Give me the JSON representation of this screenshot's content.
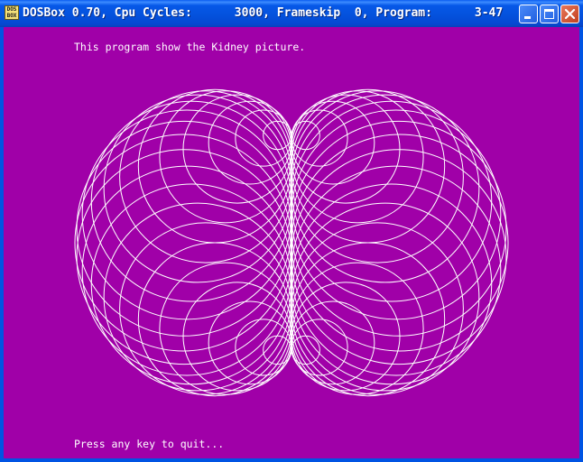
{
  "window": {
    "title": "DOSBox 0.70, Cpu Cycles:      3000, Frameskip  0, Program:      3-47",
    "icon_label_top": "DOS",
    "icon_label_bottom": "BOX",
    "controls": [
      "minimize-icon",
      "maximize-icon",
      "close-icon"
    ]
  },
  "screen": {
    "background": "#a000a8",
    "foreground": "#ffffff",
    "header_text": "This program show the Kidney picture.",
    "footer_text": "Press any key to quit..."
  }
}
